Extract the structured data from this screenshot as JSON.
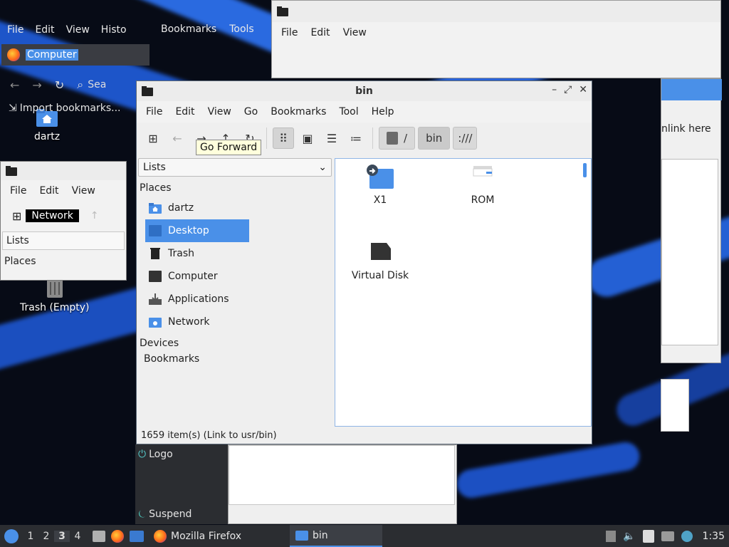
{
  "colors": {
    "accent": "#4a90e8",
    "tooltip_bg": "#ffffdc",
    "taskbar_bg": "#2b2d31"
  },
  "desktop": {
    "icons": [
      {
        "label": "dartz",
        "icon": "home-folder-icon"
      },
      {
        "label": "Trash (Empty)",
        "icon": "trash-icon"
      }
    ]
  },
  "firefox_bg": {
    "menu": [
      "File",
      "Edit",
      "View",
      "Histo",
      "Bookmarks",
      "Tools"
    ],
    "urlbar_text": "Computer",
    "search_label": "Sea",
    "import_bookmarks": "Import bookmarks..."
  },
  "left_fm_bg": {
    "menu": [
      "File",
      "Edit",
      "View"
    ],
    "location_text": "Network",
    "side_combo": "Lists",
    "places_label": "Places"
  },
  "right_fm_bg": {
    "menu": [
      "File",
      "Edit",
      "View"
    ],
    "link_text": "nlink here"
  },
  "logout_menu": {
    "items": [
      "Logo",
      "Suspend"
    ]
  },
  "fm": {
    "title": "bin",
    "menu": [
      "File",
      "Edit",
      "View",
      "Go",
      "Bookmarks",
      "Tool",
      "Help"
    ],
    "path": [
      "/",
      "bin",
      ":///"
    ],
    "tooltip": "Go Forward",
    "side_combo": "Lists",
    "places_header": "Places",
    "places": [
      {
        "label": "dartz",
        "icon": "home-folder-icon"
      },
      {
        "label": "Desktop",
        "icon": "desktop-icon",
        "selected": true
      },
      {
        "label": "Trash",
        "icon": "trash-icon"
      },
      {
        "label": "Computer",
        "icon": "computer-icon"
      },
      {
        "label": "Applications",
        "icon": "applications-icon"
      },
      {
        "label": "Network",
        "icon": "network-icon"
      }
    ],
    "devices_header": "Devices",
    "bookmarks_header": "Bookmarks",
    "files": [
      {
        "label": "X1",
        "icon": "folder-link-icon"
      },
      {
        "label": "ROM",
        "icon": "cdrom-icon"
      },
      {
        "label": "Virtual Disk",
        "icon": "drive-icon"
      }
    ],
    "status": "1659 item(s) (Link to usr/bin)"
  },
  "taskbar": {
    "workspaces": [
      "1",
      "2",
      "3",
      "4"
    ],
    "current_workspace": "3",
    "tasks": [
      {
        "label": "Mozilla Firefox",
        "icon": "firefox-icon"
      },
      {
        "label": "bin",
        "icon": "folder-icon",
        "active": true
      }
    ],
    "clock": "1:35"
  }
}
